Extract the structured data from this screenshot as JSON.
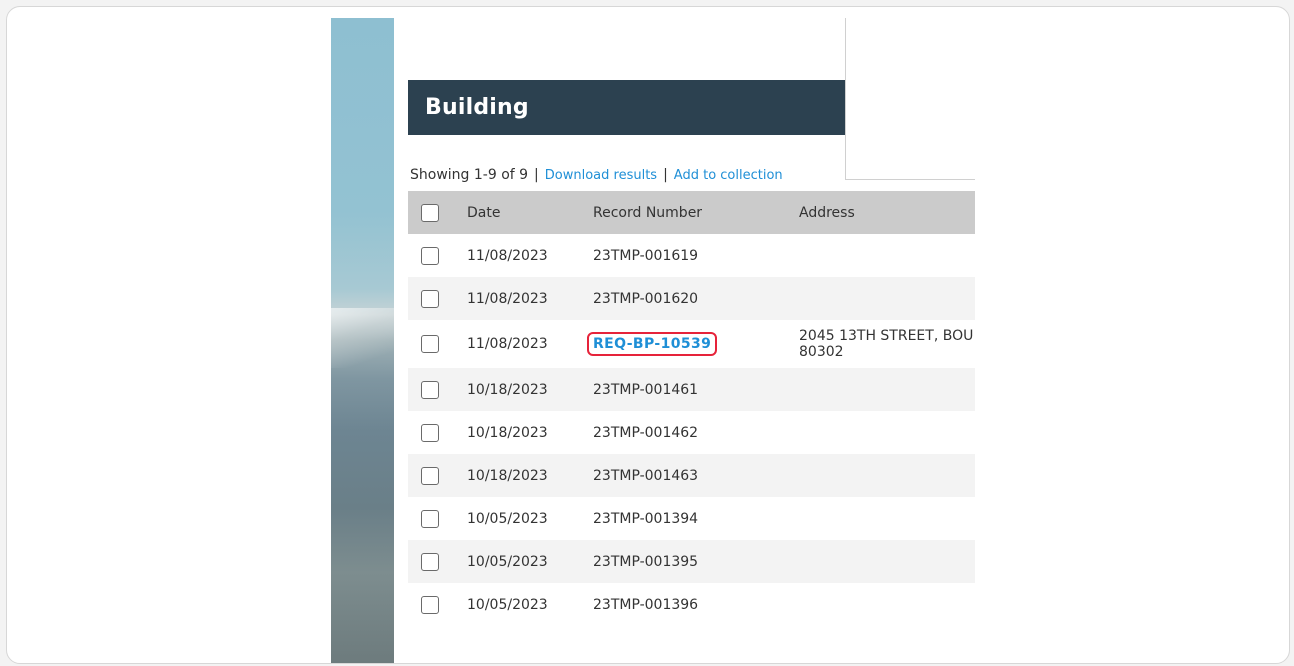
{
  "section": {
    "title": "Building"
  },
  "summary": {
    "showing": "Showing 1-9 of 9",
    "separator": "|",
    "download_link": "Download results",
    "collection_link": "Add to collection"
  },
  "table": {
    "headers": {
      "date": "Date",
      "record_number": "Record Number",
      "address": "Address"
    },
    "rows": [
      {
        "date": "11/08/2023",
        "record": "23TMP-001619",
        "address_line1": "",
        "address_line2": ""
      },
      {
        "date": "11/08/2023",
        "record": "23TMP-001620",
        "address_line1": "",
        "address_line2": ""
      },
      {
        "date": "11/08/2023",
        "record": "REQ-BP-10539",
        "address_line1": "2045 13TH STREET, BOU",
        "address_line2": "80302",
        "highlighted": true
      },
      {
        "date": "10/18/2023",
        "record": "23TMP-001461",
        "address_line1": "",
        "address_line2": ""
      },
      {
        "date": "10/18/2023",
        "record": "23TMP-001462",
        "address_line1": "",
        "address_line2": ""
      },
      {
        "date": "10/18/2023",
        "record": "23TMP-001463",
        "address_line1": "",
        "address_line2": ""
      },
      {
        "date": "10/05/2023",
        "record": "23TMP-001394",
        "address_line1": "",
        "address_line2": ""
      },
      {
        "date": "10/05/2023",
        "record": "23TMP-001395",
        "address_line1": "",
        "address_line2": ""
      },
      {
        "date": "10/05/2023",
        "record": "23TMP-001396",
        "address_line1": "",
        "address_line2": ""
      }
    ]
  },
  "colors": {
    "header_bg": "#2c4150",
    "link": "#1f8fd6",
    "highlight_border": "#e6233a",
    "table_header_bg": "#cbcbcb",
    "row_alt_bg": "#f3f3f3"
  }
}
